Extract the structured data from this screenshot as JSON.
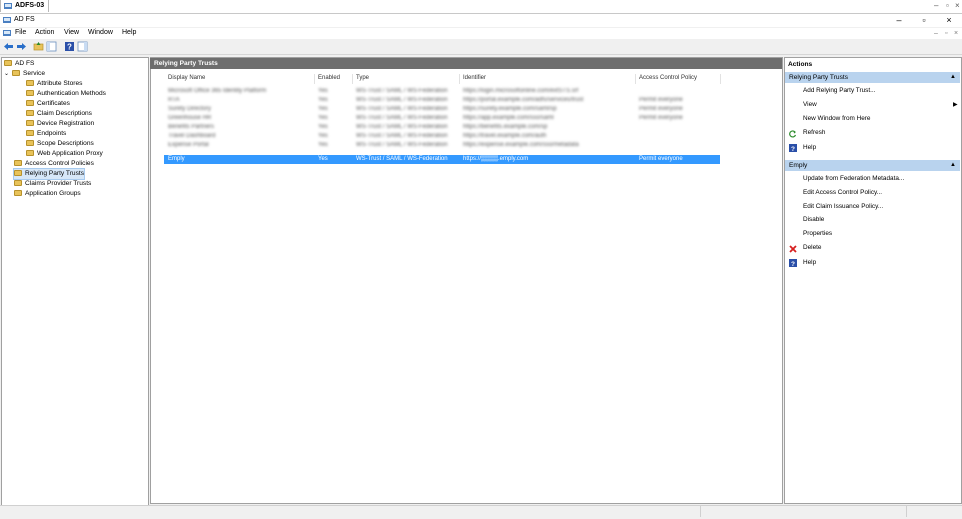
{
  "session_tab": {
    "label": "ADFS-03"
  },
  "window": {
    "title": "AD FS"
  },
  "menu": {
    "items": [
      "File",
      "Action",
      "View",
      "Window",
      "Help"
    ]
  },
  "tree": {
    "root": "AD FS",
    "service": "Service",
    "service_children": [
      "Attribute Stores",
      "Authentication Methods",
      "Certificates",
      "Claim Descriptions",
      "Device Registration",
      "Endpoints",
      "Scope Descriptions",
      "Web Application Proxy"
    ],
    "top_items": [
      "Access Control Policies",
      "Relying Party Trusts",
      "Claims Provider Trusts",
      "Application Groups"
    ],
    "selected": "Relying Party Trusts"
  },
  "center": {
    "title": "Relying Party Trusts",
    "columns": [
      "Display Name",
      "Enabled",
      "Type",
      "Identifier",
      "Access Control Policy"
    ],
    "blurred_rows": [
      [
        "Microsoft Office 365 Identity Platform",
        "Yes",
        "WS-Trust / SAML / WS-Federation",
        "https://login.microsoftonline.com/extSTS.srf",
        ""
      ],
      [
        "RTA",
        "Yes",
        "WS-Trust / SAML / WS-Federation",
        "https://portal.example.com/adfs/services/trust",
        "Permit everyone"
      ],
      [
        "Surety Directory",
        "Yes",
        "WS-Trust / SAML / WS-Federation",
        "https://surety.example.com/saml/sp",
        "Permit everyone"
      ],
      [
        "Greenhouse HR",
        "Yes",
        "WS-Trust / SAML / WS-Federation",
        "https://app.example.com/sso/saml",
        "Permit everyone"
      ],
      [
        "Benefits Partners",
        "Yes",
        "WS-Trust / SAML / WS-Federation",
        "https://benefits.example.com/sp",
        ""
      ],
      [
        "Travel Dashboard",
        "Yes",
        "WS-Trust / SAML / WS-Federation",
        "https://travel.example.com/auth",
        ""
      ],
      [
        "Expense Portal",
        "Yes",
        "WS-Trust / SAML / WS-Federation",
        "https://expense.example.com/sso/metadata",
        ""
      ]
    ],
    "selected_row": {
      "name": "Emply",
      "enabled": "Yes",
      "type": "WS-Trust / SAML / WS-Federation",
      "identifier": "https://▒▒▒▒.emply.com",
      "policy": "Permit everyone"
    }
  },
  "actions": {
    "title": "Actions",
    "section1": {
      "header": "Relying Party Trusts",
      "items": [
        "Add Relying Party Trust...",
        "View",
        "New Window from Here",
        "Refresh",
        "Help"
      ]
    },
    "section2": {
      "header": "Emply",
      "items": [
        "Update from Federation Metadata...",
        "Edit Access Control Policy...",
        "Edit Claim Issuance Policy...",
        "Disable",
        "Properties",
        "Delete",
        "Help"
      ]
    }
  },
  "colors": {
    "selection": "#3399ff",
    "action_header": "#b9d3ee",
    "panel_header": "#6e6e6e"
  }
}
